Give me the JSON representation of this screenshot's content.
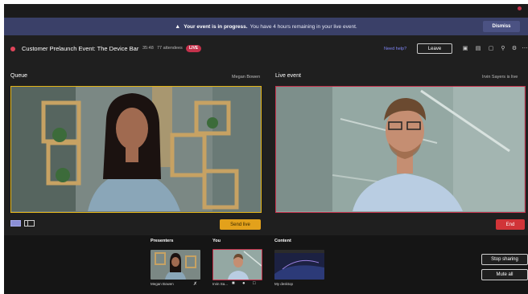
{
  "banner": {
    "bold_text": "Your event is in progress.",
    "text": "You have 4 hours remaining in your live event.",
    "dismiss_label": "Dismiss",
    "color": "#3a4068"
  },
  "header": {
    "title": "Customer Prelaunch Event: The Device Bar",
    "timer": "35:48",
    "attendees": "77 attendees",
    "live_badge": "LIVE",
    "need_help": "Need help?",
    "leave_label": "Leave",
    "tool_icons": [
      "chat-icon",
      "notes-icon",
      "qa-icon",
      "people-icon",
      "settings-icon",
      "more-icon"
    ]
  },
  "queue": {
    "label": "Queue",
    "presenter_name": "Megan Bowen",
    "send_live_label": "Send live",
    "border_color": "#e3b417"
  },
  "live_event": {
    "label": "Live event",
    "presenter_name": "Irvin Sayers is live",
    "end_label": "End",
    "border_color": "#c4314b"
  },
  "bottom": {
    "presenters_label": "Presenters",
    "you_label": "You",
    "content_label": "Content",
    "presenter_thumb_name": "Megan Bowen",
    "you_thumb_name": "Irvin Sa...",
    "content_thumb_name": "My desktop",
    "stop_sharing_label": "Stop sharing",
    "mute_all_label": "Mute all"
  }
}
